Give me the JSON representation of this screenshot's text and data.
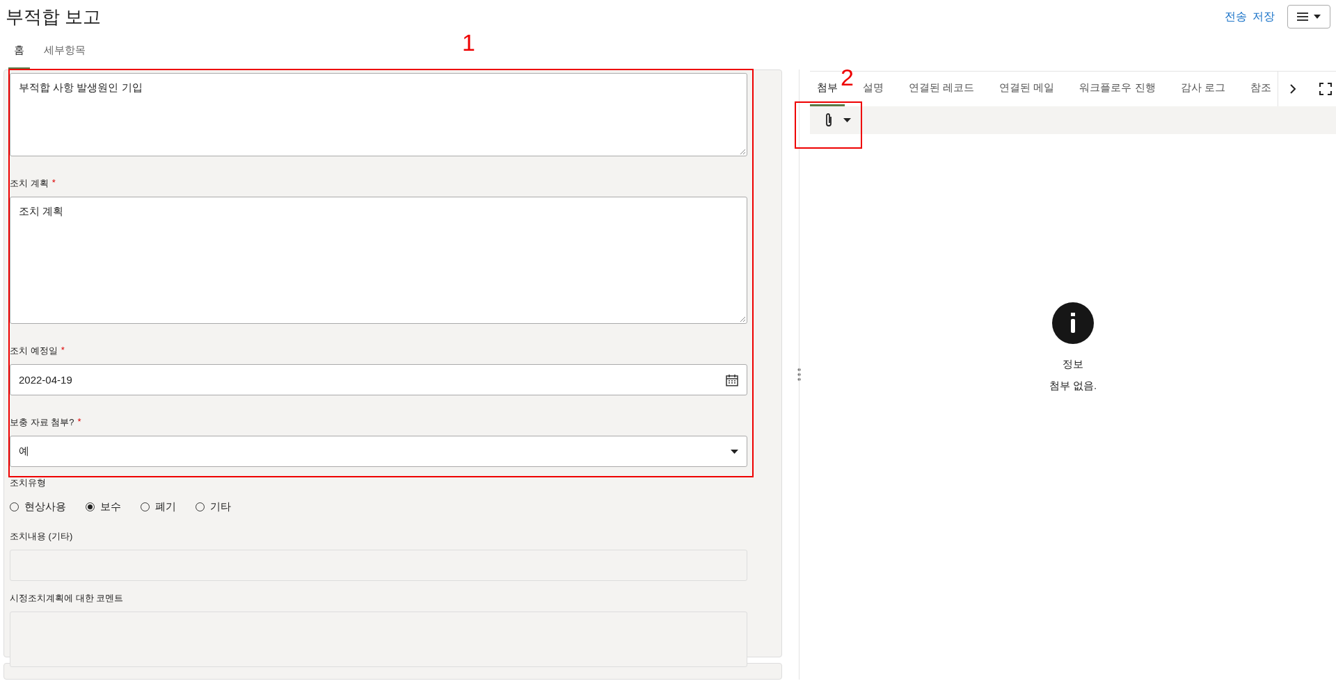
{
  "title": "부적합 보고",
  "header_actions": [
    {
      "label": "전송"
    },
    {
      "label": "저장"
    }
  ],
  "tabs": [
    {
      "label": "홈",
      "selected": true
    },
    {
      "label": "세부항목",
      "selected": false
    }
  ],
  "form": {
    "fields": [
      {
        "kind": "textarea",
        "value": "부적합 사항 발생원인 기입",
        "disabled": false
      },
      {
        "kind": "textarea",
        "label": "조치 계획",
        "required_mark": "*",
        "value": "조치 계획",
        "disabled": false
      },
      {
        "kind": "date",
        "label": "조치 예정일",
        "required_mark": "*",
        "value": "2022-04-19",
        "disabled": false
      },
      {
        "kind": "select",
        "label": "보충 자료 첨부?",
        "required_mark": "*",
        "value": "예",
        "disabled": false
      },
      {
        "kind": "radio",
        "label": "조치유형",
        "options": [
          {
            "label": "현상사용",
            "selected": false
          },
          {
            "label": "보수",
            "selected": true
          },
          {
            "label": "폐기",
            "selected": false
          },
          {
            "label": "기타",
            "selected": false
          }
        ]
      },
      {
        "kind": "text",
        "label": "조치내용 (기타)",
        "disabled": true
      },
      {
        "kind": "textarea",
        "label": "시정조치계획에 대한 코멘트",
        "disabled": true
      }
    ]
  },
  "right_tabs": [
    {
      "label": "첨부",
      "selected": true
    },
    {
      "label": "설명",
      "selected": false
    },
    {
      "label": "연결된 레코드",
      "selected": false
    },
    {
      "label": "연결된 메일",
      "selected": false
    },
    {
      "label": "워크플로우 진행",
      "selected": false
    },
    {
      "label": "감사 로그",
      "selected": false
    },
    {
      "label": "참조",
      "selected": false
    }
  ],
  "empty_state": {
    "title": "정보",
    "message": "첨부 없음."
  },
  "annotations": [
    {
      "label": "1"
    },
    {
      "label": "2"
    }
  ]
}
